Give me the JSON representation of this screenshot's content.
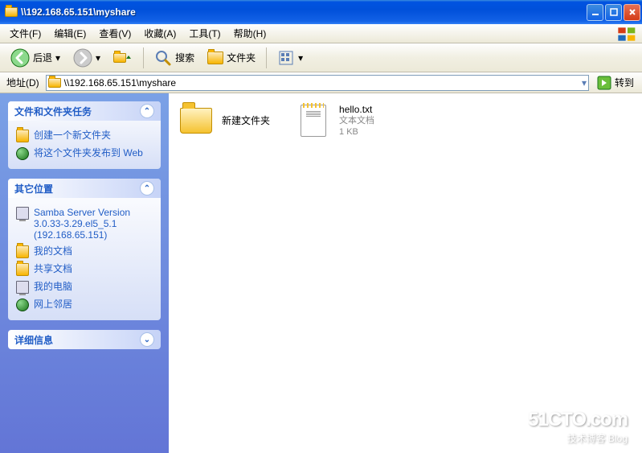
{
  "window": {
    "title": "\\\\192.168.65.151\\myshare"
  },
  "menu": {
    "file": "文件(F)",
    "edit": "编辑(E)",
    "view": "查看(V)",
    "favorites": "收藏(A)",
    "tools": "工具(T)",
    "help": "帮助(H)"
  },
  "toolbar": {
    "back": "后退",
    "search": "搜索",
    "folders": "文件夹"
  },
  "addressbar": {
    "label": "地址(D)",
    "path": "\\\\192.168.65.151\\myshare",
    "go": "转到"
  },
  "sidebar": {
    "tasks": {
      "title": "文件和文件夹任务",
      "items": [
        "创建一个新文件夹",
        "将这个文件夹发布到 Web"
      ]
    },
    "other": {
      "title": "其它位置",
      "items": [
        "Samba Server Version 3.0.33-3.29.el5_5.1 (192.168.65.151)",
        "我的文档",
        "共享文档",
        "我的电脑",
        "网上邻居"
      ]
    },
    "details": {
      "title": "详细信息"
    }
  },
  "files": {
    "folder": {
      "name": "新建文件夹"
    },
    "txt": {
      "name": "hello.txt",
      "type": "文本文档",
      "size": "1 KB"
    }
  },
  "watermark": {
    "brand": "51CTO.com",
    "sub": "技术博客  Blog"
  }
}
